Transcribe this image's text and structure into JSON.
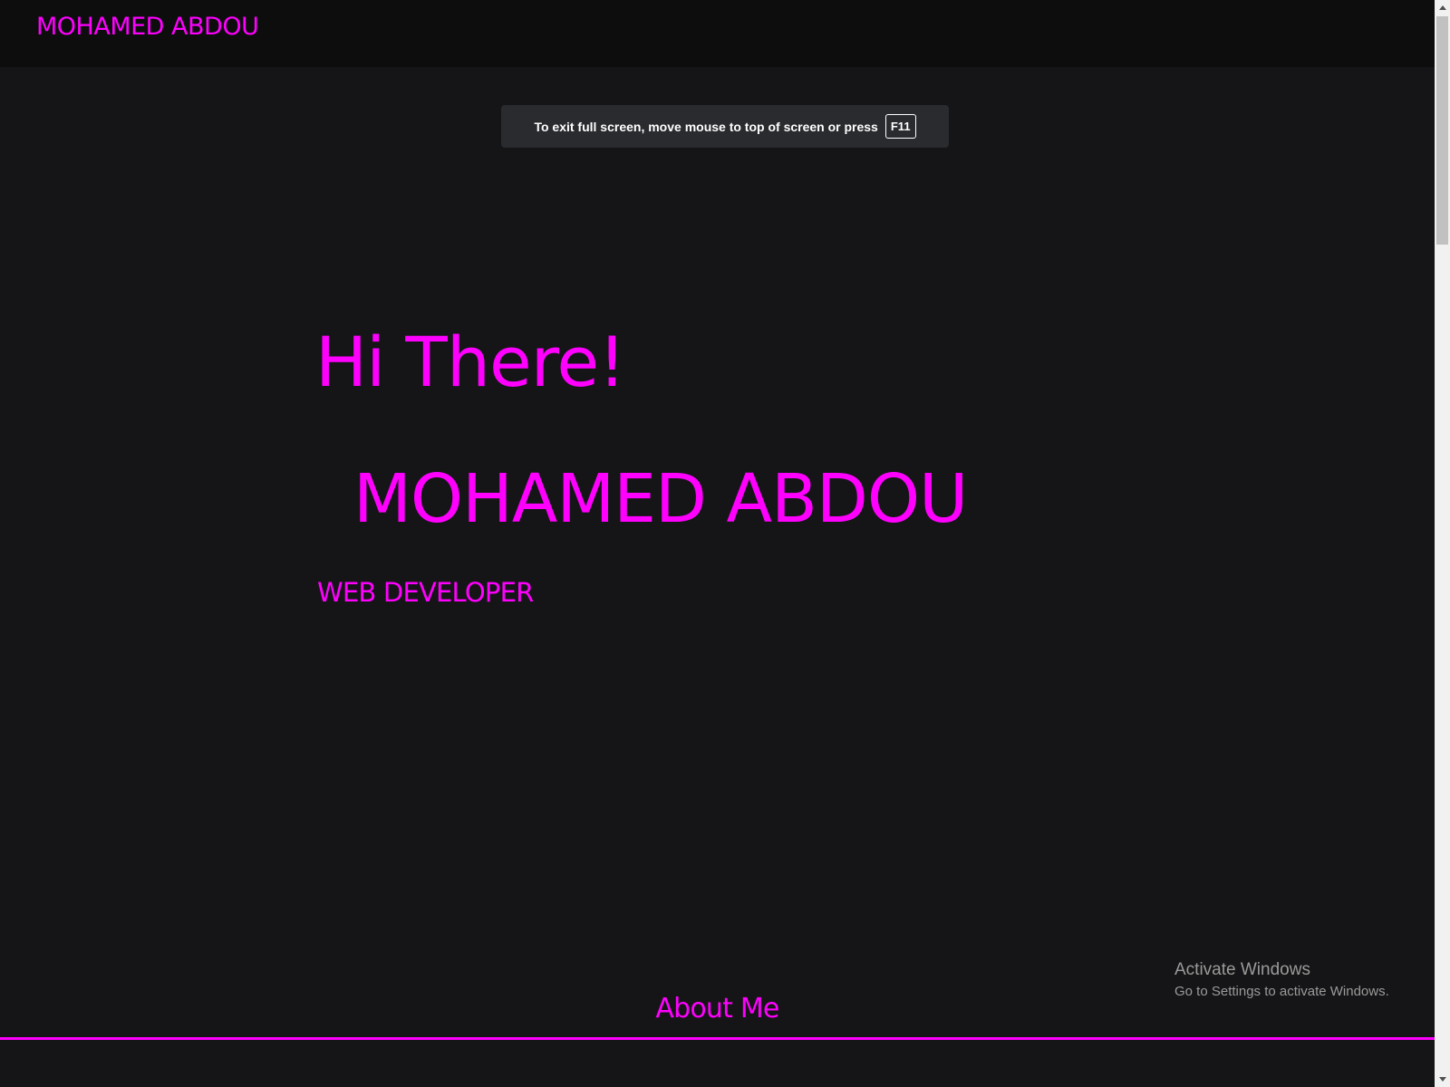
{
  "navbar": {
    "brand": "MOHAMED ABDOU"
  },
  "fullscreen_notice": {
    "message": "To exit full screen, move mouse to top of screen or press",
    "key": "F11"
  },
  "hero": {
    "greeting": "Hi There!",
    "name": "MOHAMED ABDOU",
    "role": "WEB DEVELOPER"
  },
  "about": {
    "heading": "About Me"
  },
  "windows_watermark": {
    "title": "Activate Windows",
    "subtitle": "Go to Settings to activate Windows."
  },
  "colors": {
    "accent": "#ff00ff",
    "background": "#151517",
    "navbar": "#0d0d0e"
  }
}
